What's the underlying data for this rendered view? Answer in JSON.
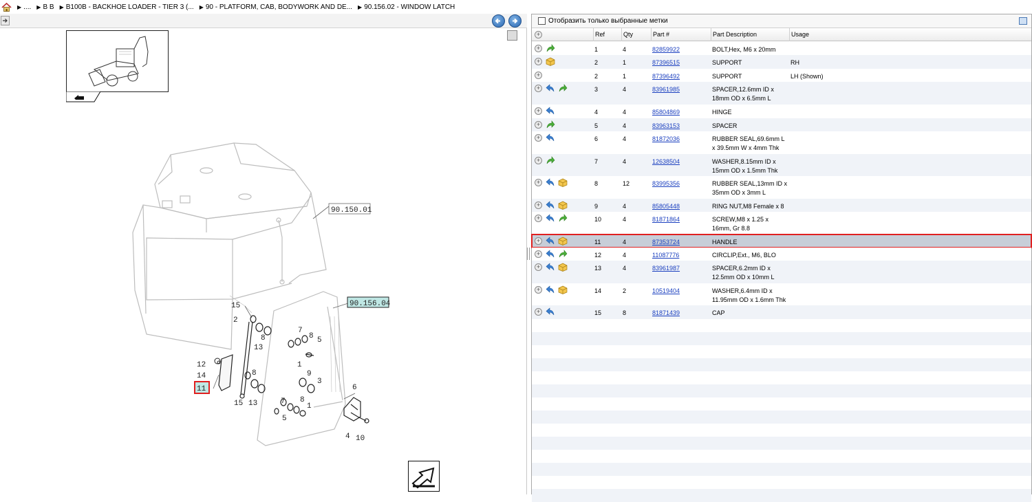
{
  "breadcrumb": [
    "....",
    "B B",
    "B100B - BACKHOE LOADER - TIER 3 (...",
    "90 - PLATFORM, CAB, BODYWORK AND DE...",
    "90.156.02 - WINDOW LATCH"
  ],
  "diagram": {
    "callouts": {
      "ref_90_150_01": "90.150.01",
      "ref_90_156_04": "90.156.04",
      "n1": "1",
      "n2": "2",
      "n3": "3",
      "n4": "4",
      "n5": "5",
      "n6": "6",
      "n7": "7",
      "n8": "8",
      "n9": "9",
      "n10": "10",
      "n11": "11",
      "n12": "12",
      "n13": "13",
      "n14": "14",
      "n15": "15"
    }
  },
  "filter": {
    "label": "Отобразить только выбранные метки"
  },
  "table": {
    "headers": {
      "ref": "Ref",
      "qty": "Qty",
      "part": "Part #",
      "desc": "Part Description",
      "usage": "Usage"
    },
    "rows": [
      {
        "ref": "1",
        "qty": "4",
        "part": "82859922",
        "desc": "BOLT,Hex, M6 x 20mm",
        "usage": "",
        "icons": [
          "green-arrow-icon"
        ]
      },
      {
        "ref": "2",
        "qty": "1",
        "part": "87396515",
        "desc": "SUPPORT",
        "usage": "RH",
        "icons": [
          "box-icon"
        ]
      },
      {
        "ref": "2",
        "qty": "1",
        "part": "87396492",
        "desc": "SUPPORT",
        "usage": "LH (Shown)",
        "icons": []
      },
      {
        "ref": "3",
        "qty": "4",
        "part": "83961985",
        "desc": "SPACER,12.6mm ID x 18mm OD x 6.5mm L",
        "usage": "",
        "icons": [
          "blue-arrow-icon",
          "green-arrow-icon"
        ]
      },
      {
        "ref": "4",
        "qty": "4",
        "part": "85804869",
        "desc": "HINGE",
        "usage": "",
        "icons": [
          "blue-arrow-icon"
        ]
      },
      {
        "ref": "5",
        "qty": "4",
        "part": "83963153",
        "desc": "SPACER",
        "usage": "",
        "icons": [
          "green-arrow-icon"
        ]
      },
      {
        "ref": "6",
        "qty": "4",
        "part": "81872036",
        "desc": "RUBBER SEAL,69.6mm L x 39.5mm W x 4mm Thk",
        "usage": "",
        "icons": [
          "blue-arrow-icon"
        ]
      },
      {
        "ref": "7",
        "qty": "4",
        "part": "12638504",
        "desc": "WASHER,8.15mm ID x 15mm OD x 1.5mm Thk",
        "usage": "",
        "icons": [
          "green-arrow-icon"
        ]
      },
      {
        "ref": "8",
        "qty": "12",
        "part": "83995356",
        "desc": "RUBBER SEAL,13mm ID x 35mm OD x 3mm L",
        "usage": "",
        "icons": [
          "blue-arrow-icon",
          "box-icon"
        ]
      },
      {
        "ref": "9",
        "qty": "4",
        "part": "85805448",
        "desc": "RING NUT,M8 Female x 8",
        "usage": "",
        "icons": [
          "blue-arrow-icon",
          "box-icon"
        ]
      },
      {
        "ref": "10",
        "qty": "4",
        "part": "81871864",
        "desc": "SCREW,M8 x 1.25 x 16mm, Gr 8.8",
        "usage": "",
        "icons": [
          "blue-arrow-icon",
          "green-arrow-icon"
        ]
      },
      {
        "ref": "11",
        "qty": "4",
        "part": "87353724",
        "desc": "HANDLE",
        "usage": "",
        "icons": [
          "blue-arrow-icon",
          "box-icon"
        ],
        "selected": true
      },
      {
        "ref": "12",
        "qty": "4",
        "part": "11087776",
        "desc": "CIRCLIP,Ext., M6, BLO",
        "usage": "",
        "icons": [
          "blue-arrow-icon",
          "green-arrow-icon"
        ]
      },
      {
        "ref": "13",
        "qty": "4",
        "part": "83961987",
        "desc": "SPACER,6.2mm ID x 12.5mm OD x 10mm L",
        "usage": "",
        "icons": [
          "blue-arrow-icon",
          "box-icon"
        ]
      },
      {
        "ref": "14",
        "qty": "2",
        "part": "10519404",
        "desc": "WASHER,6.4mm ID x 11.95mm OD x 1.6mm Thk",
        "usage": "",
        "icons": [
          "blue-arrow-icon",
          "box-icon"
        ]
      },
      {
        "ref": "15",
        "qty": "8",
        "part": "81871439",
        "desc": "CAP",
        "usage": "",
        "icons": [
          "blue-arrow-icon"
        ]
      }
    ]
  },
  "colors": {
    "selected_row": "#c7ced8",
    "highlight": "#e02020",
    "link": "#1a3fbf",
    "callout_highlight": "#bfe7e4"
  }
}
